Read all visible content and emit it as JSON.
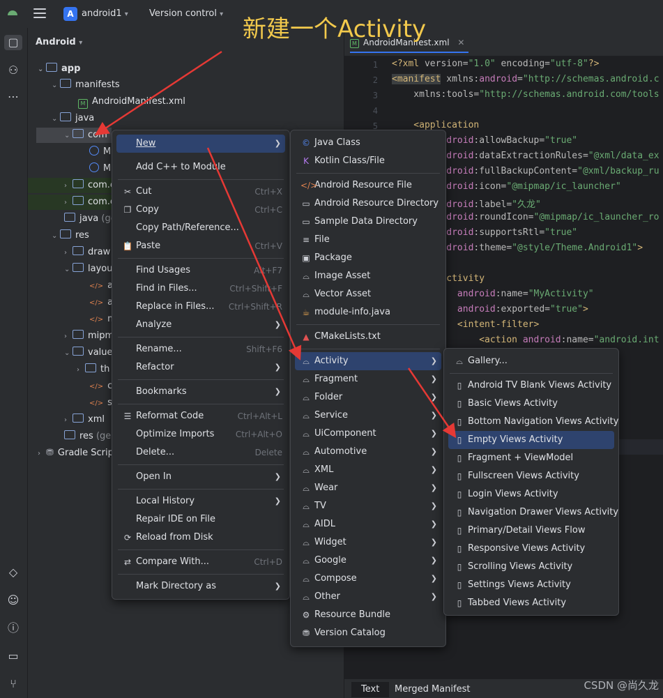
{
  "annotation": "新建一个Activity",
  "watermark": "CSDN @尚久龙",
  "topbar": {
    "project_badge": "A",
    "project": "android1",
    "vcs": "Version control"
  },
  "pane": {
    "title": "Android"
  },
  "tree": [
    {
      "label": "app",
      "bold": true
    },
    {
      "label": "manifests"
    },
    {
      "label": "AndroidManifest.xml"
    },
    {
      "label": "java"
    },
    {
      "label": "com"
    },
    {
      "label": "M"
    },
    {
      "label": "M"
    },
    {
      "label": "com.e"
    },
    {
      "label": "com.e"
    },
    {
      "label": "java",
      "suffix": "(gen"
    },
    {
      "label": "res"
    },
    {
      "label": "draw"
    },
    {
      "label": "layou"
    },
    {
      "label": "ac"
    },
    {
      "label": "ac"
    },
    {
      "label": "m"
    },
    {
      "label": "mipm"
    },
    {
      "label": "value"
    },
    {
      "label": "th"
    },
    {
      "label": "co"
    },
    {
      "label": "st"
    },
    {
      "label": "xml"
    },
    {
      "label": "res",
      "suffix": "(gen"
    },
    {
      "label": "Gradle Scrip"
    }
  ],
  "editor": {
    "tab": "AndroidManifest.xml",
    "bottom_tabs": [
      "Text",
      "Merged Manifest"
    ],
    "line_numbers": [
      "1",
      "2",
      "3",
      "4",
      "5"
    ]
  },
  "menu1": [
    {
      "label": "New",
      "submenu": true,
      "active": true
    },
    {
      "label": "Add C++ to Module"
    },
    {
      "label": "Cut",
      "shortcut": "Ctrl+X",
      "icon": "cut-icon"
    },
    {
      "label": "Copy",
      "shortcut": "Ctrl+C",
      "icon": "copy-icon"
    },
    {
      "label": "Copy Path/Reference..."
    },
    {
      "label": "Paste",
      "shortcut": "Ctrl+V",
      "icon": "paste-icon"
    },
    {
      "label": "Find Usages",
      "shortcut": "Alt+F7"
    },
    {
      "label": "Find in Files...",
      "shortcut": "Ctrl+Shift+F"
    },
    {
      "label": "Replace in Files...",
      "shortcut": "Ctrl+Shift+R"
    },
    {
      "label": "Analyze",
      "submenu": true
    },
    {
      "label": "Rename...",
      "shortcut": "Shift+F6"
    },
    {
      "label": "Refactor",
      "submenu": true
    },
    {
      "label": "Bookmarks",
      "submenu": true
    },
    {
      "label": "Reformat Code",
      "shortcut": "Ctrl+Alt+L",
      "icon": "reformat-icon"
    },
    {
      "label": "Optimize Imports",
      "shortcut": "Ctrl+Alt+O"
    },
    {
      "label": "Delete...",
      "shortcut": "Delete"
    },
    {
      "label": "Open In",
      "submenu": true
    },
    {
      "label": "Local History",
      "submenu": true
    },
    {
      "label": "Repair IDE on File"
    },
    {
      "label": "Reload from Disk",
      "icon": "reload-icon"
    },
    {
      "label": "Compare With...",
      "shortcut": "Ctrl+D",
      "icon": "compare-icon"
    },
    {
      "label": "Mark Directory as",
      "submenu": true
    }
  ],
  "menu2": [
    {
      "label": "Java Class"
    },
    {
      "label": "Kotlin Class/File"
    },
    {
      "label": "Android Resource File"
    },
    {
      "label": "Android Resource Directory"
    },
    {
      "label": "Sample Data Directory"
    },
    {
      "label": "File"
    },
    {
      "label": "Package"
    },
    {
      "label": "Image Asset"
    },
    {
      "label": "Vector Asset"
    },
    {
      "label": "module-info.java"
    },
    {
      "label": "CMakeLists.txt"
    },
    {
      "label": "Activity",
      "active": true
    },
    {
      "label": "Fragment"
    },
    {
      "label": "Folder"
    },
    {
      "label": "Service"
    },
    {
      "label": "UiComponent"
    },
    {
      "label": "Automotive"
    },
    {
      "label": "XML"
    },
    {
      "label": "Wear"
    },
    {
      "label": "TV"
    },
    {
      "label": "AIDL"
    },
    {
      "label": "Widget"
    },
    {
      "label": "Google"
    },
    {
      "label": "Compose"
    },
    {
      "label": "Other"
    },
    {
      "label": "Resource Bundle"
    },
    {
      "label": "Version Catalog"
    }
  ],
  "menu3": [
    {
      "label": "Gallery..."
    },
    {
      "label": "Android TV Blank Views Activity"
    },
    {
      "label": "Basic Views Activity"
    },
    {
      "label": "Bottom Navigation Views Activity"
    },
    {
      "label": "Empty Views Activity",
      "active": true
    },
    {
      "label": "Fragment + ViewModel"
    },
    {
      "label": "Fullscreen Views Activity"
    },
    {
      "label": "Login Views Activity"
    },
    {
      "label": "Navigation Drawer Views Activity"
    },
    {
      "label": "Primary/Detail Views Flow"
    },
    {
      "label": "Responsive Views Activity"
    },
    {
      "label": "Scrolling Views Activity"
    },
    {
      "label": "Settings Views Activity"
    },
    {
      "label": "Tabbed Views Activity"
    }
  ],
  "colors": {
    "accent": "#3574f0",
    "selection": "#2e436e",
    "annotation": "#f2c94c",
    "arrow": "#e53935"
  }
}
